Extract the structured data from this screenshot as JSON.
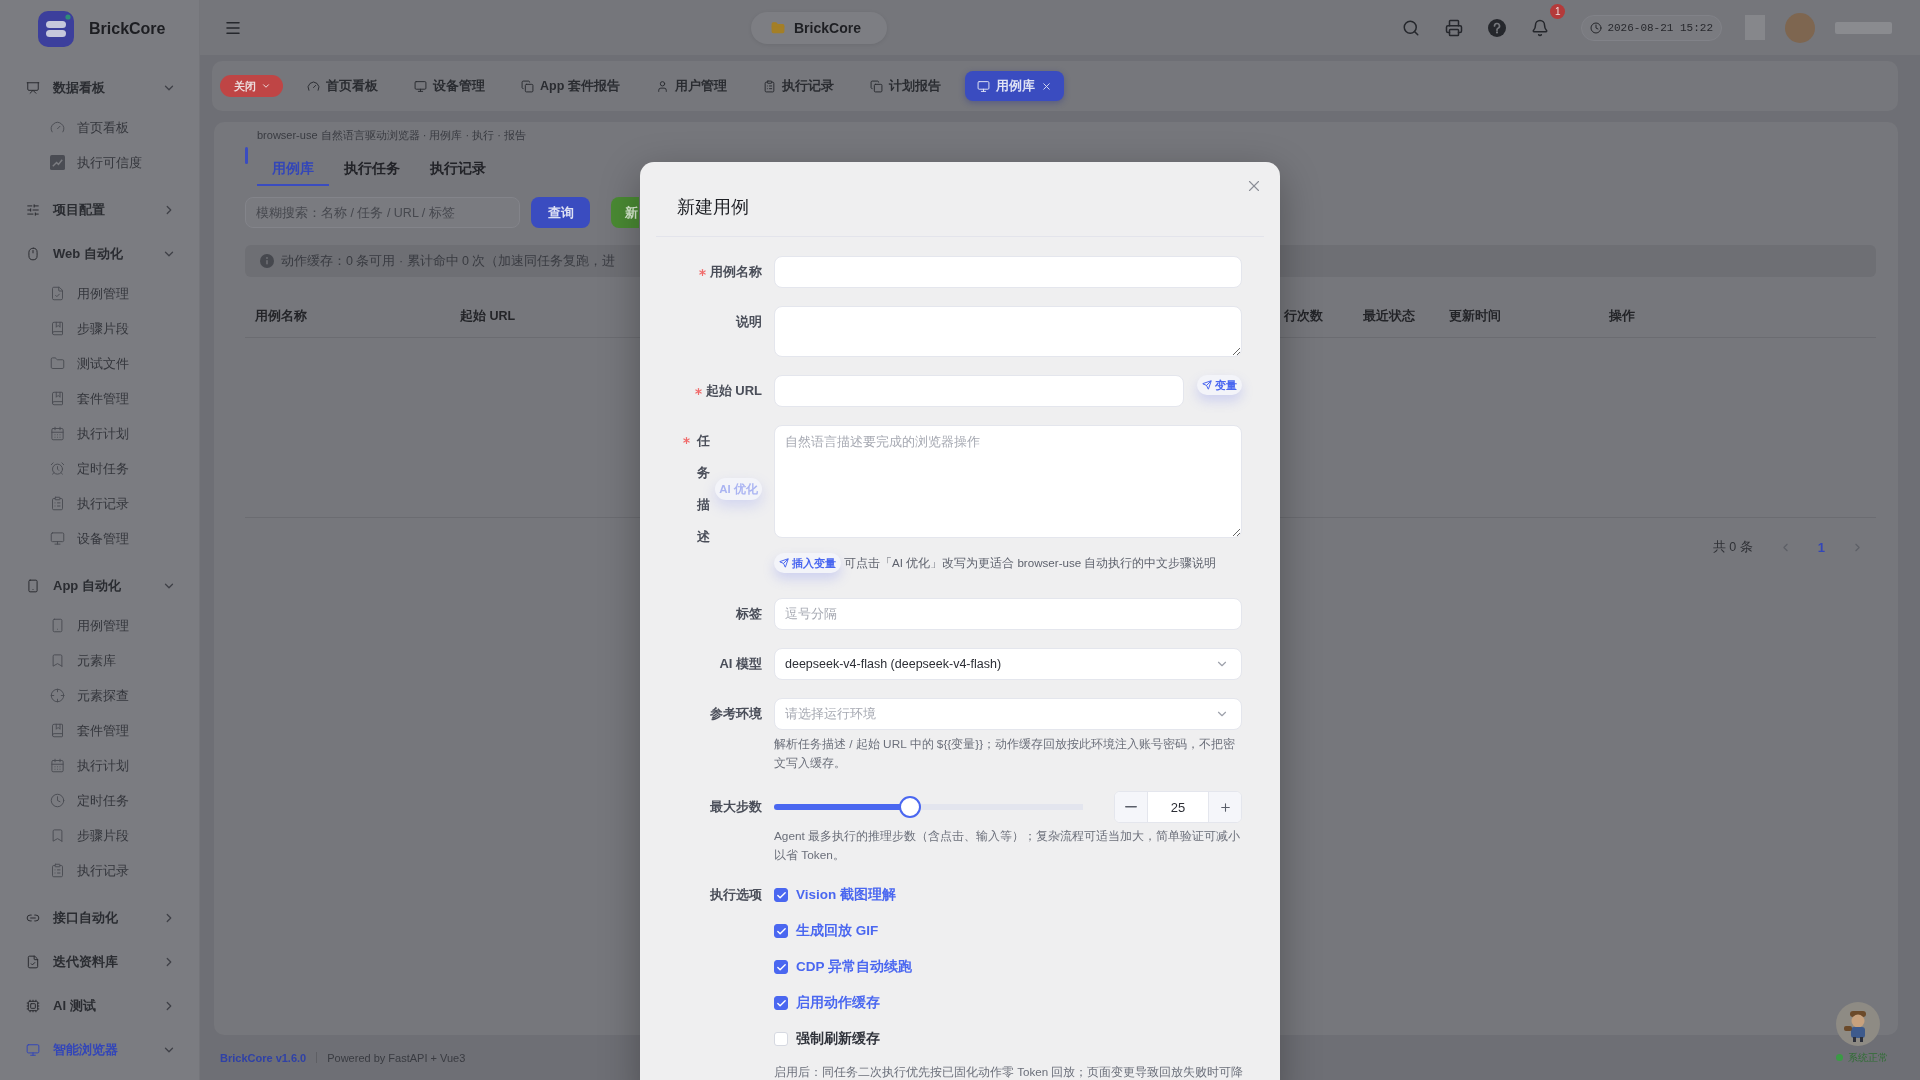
{
  "sidebar": {
    "brand": "BrickCore",
    "groups": [
      {
        "label": "数据看板",
        "expanded": true,
        "selected": false,
        "children": [
          {
            "label": "首页看板",
            "selected": false
          },
          {
            "label": "执行可信度",
            "selected": false
          }
        ]
      },
      {
        "label": "项目配置",
        "expanded": false,
        "selected": false
      },
      {
        "label": "Web 自动化",
        "expanded": true,
        "selected": false,
        "children": [
          {
            "label": "用例管理",
            "selected": false
          },
          {
            "label": "步骤片段",
            "selected": false
          },
          {
            "label": "测试文件",
            "selected": false
          },
          {
            "label": "套件管理",
            "selected": false
          },
          {
            "label": "执行计划",
            "selected": false
          },
          {
            "label": "定时任务",
            "selected": false
          },
          {
            "label": "执行记录",
            "selected": false
          },
          {
            "label": "设备管理",
            "selected": false
          }
        ]
      },
      {
        "label": "App 自动化",
        "expanded": true,
        "selected": false,
        "children": [
          {
            "label": "用例管理",
            "selected": false
          },
          {
            "label": "元素库",
            "selected": false
          },
          {
            "label": "元素探查",
            "selected": false
          },
          {
            "label": "套件管理",
            "selected": false
          },
          {
            "label": "执行计划",
            "selected": false
          },
          {
            "label": "定时任务",
            "selected": false
          },
          {
            "label": "步骤片段",
            "selected": false
          },
          {
            "label": "执行记录",
            "selected": false
          }
        ]
      },
      {
        "label": "接口自动化",
        "expanded": false,
        "selected": false
      },
      {
        "label": "迭代资料库",
        "expanded": false,
        "selected": false
      },
      {
        "label": "AI 测试",
        "expanded": false,
        "selected": false
      },
      {
        "label": "智能浏览器",
        "expanded": true,
        "selected": true
      }
    ]
  },
  "topbar": {
    "project": "BrickCore",
    "notification_count": "1",
    "datetime": "2026-08-21 15:22"
  },
  "open_tabs": {
    "close_label": "关闭",
    "tabs": [
      {
        "label": "首页看板",
        "selected": false
      },
      {
        "label": "设备管理",
        "selected": false
      },
      {
        "label": "App 套件报告",
        "selected": false
      },
      {
        "label": "用户管理",
        "selected": false
      },
      {
        "label": "执行记录",
        "selected": false
      },
      {
        "label": "计划报告",
        "selected": false
      },
      {
        "label": "用例库",
        "selected": true
      }
    ]
  },
  "page": {
    "breadcrumb": "browser-use 自然语言驱动浏览器 · 用例库 · 执行 · 报告",
    "tabs": [
      {
        "label": "用例库",
        "selected": true
      },
      {
        "label": "执行任务",
        "selected": false
      },
      {
        "label": "执行记录",
        "selected": false
      }
    ],
    "search": {
      "placeholder": "模糊搜索：名称 / 任务 / URL / 标签"
    },
    "query_button": "查询",
    "new_button": "新",
    "notice": "动作缓存：0 条可用 · 累计命中 0 次（加速同任务复跑，进",
    "table": {
      "columns": [
        "用例名称",
        "起始 URL",
        "行次数",
        "最近状态",
        "更新时间",
        "操作"
      ]
    },
    "pagination": {
      "total": "共 0 条",
      "pages": [
        {
          "label": "1",
          "selected": true
        }
      ]
    }
  },
  "dialog": {
    "title": "新建用例",
    "fields": [
      {
        "kind": "input",
        "label": "用例名称",
        "required": true
      },
      {
        "kind": "textarea",
        "label": "说明",
        "required": false
      },
      {
        "kind": "url",
        "label": "起始 URL",
        "required": true,
        "variable_button": "变量"
      },
      {
        "kind": "task",
        "label": "任务描述",
        "required": true,
        "assist_button": {
          "label": "AI 优化",
          "disabled": true
        },
        "placeholder": "自然语言描述要完成的浏览器操作",
        "insert_button": "插入变量",
        "hint": "可点击「AI 优化」改写为更适合 browser-use 自动执行的中文步骤说明"
      },
      {
        "kind": "input",
        "label": "标签",
        "required": false,
        "placeholder": "逗号分隔"
      },
      {
        "kind": "select",
        "label": "AI 模型",
        "required": false,
        "value": "deepseek-v4-flash (deepseek-v4-flash)"
      },
      {
        "kind": "select",
        "label": "参考环境",
        "required": false,
        "placeholder": "请选择运行环境",
        "hint": "解析任务描述 / 起始 URL 中的 ${{变量}}；动作缓存回放按此环境注入账号密码，不把密文写入缓存。"
      },
      {
        "kind": "slider",
        "label": "最大步数",
        "required": false,
        "level": 0.44,
        "value": "25",
        "hint": "Agent 最多执行的推理步数（含点击、输入等）；复杂流程可适当加大，简单验证可减小以省 Token。"
      },
      {
        "kind": "options",
        "label": "执行选项",
        "required": false,
        "options": [
          {
            "label": "Vision 截图理解",
            "checked": true
          },
          {
            "label": "生成回放 GIF",
            "checked": true
          },
          {
            "label": "CDP 异常自动续跑",
            "checked": true
          },
          {
            "label": "启用动作缓存",
            "checked": true
          },
          {
            "label": "强制刷新缓存",
            "checked": false
          }
        ],
        "hint": "启用后：同任务二次执行优先按已固化动作零 Token 回放；页面变更导致回放失败时可降"
      }
    ]
  },
  "footer": {
    "version": "BrickCore v1.6.0",
    "powered_by": "Powered by FastAPI + Vue3",
    "status": "系统正常"
  }
}
